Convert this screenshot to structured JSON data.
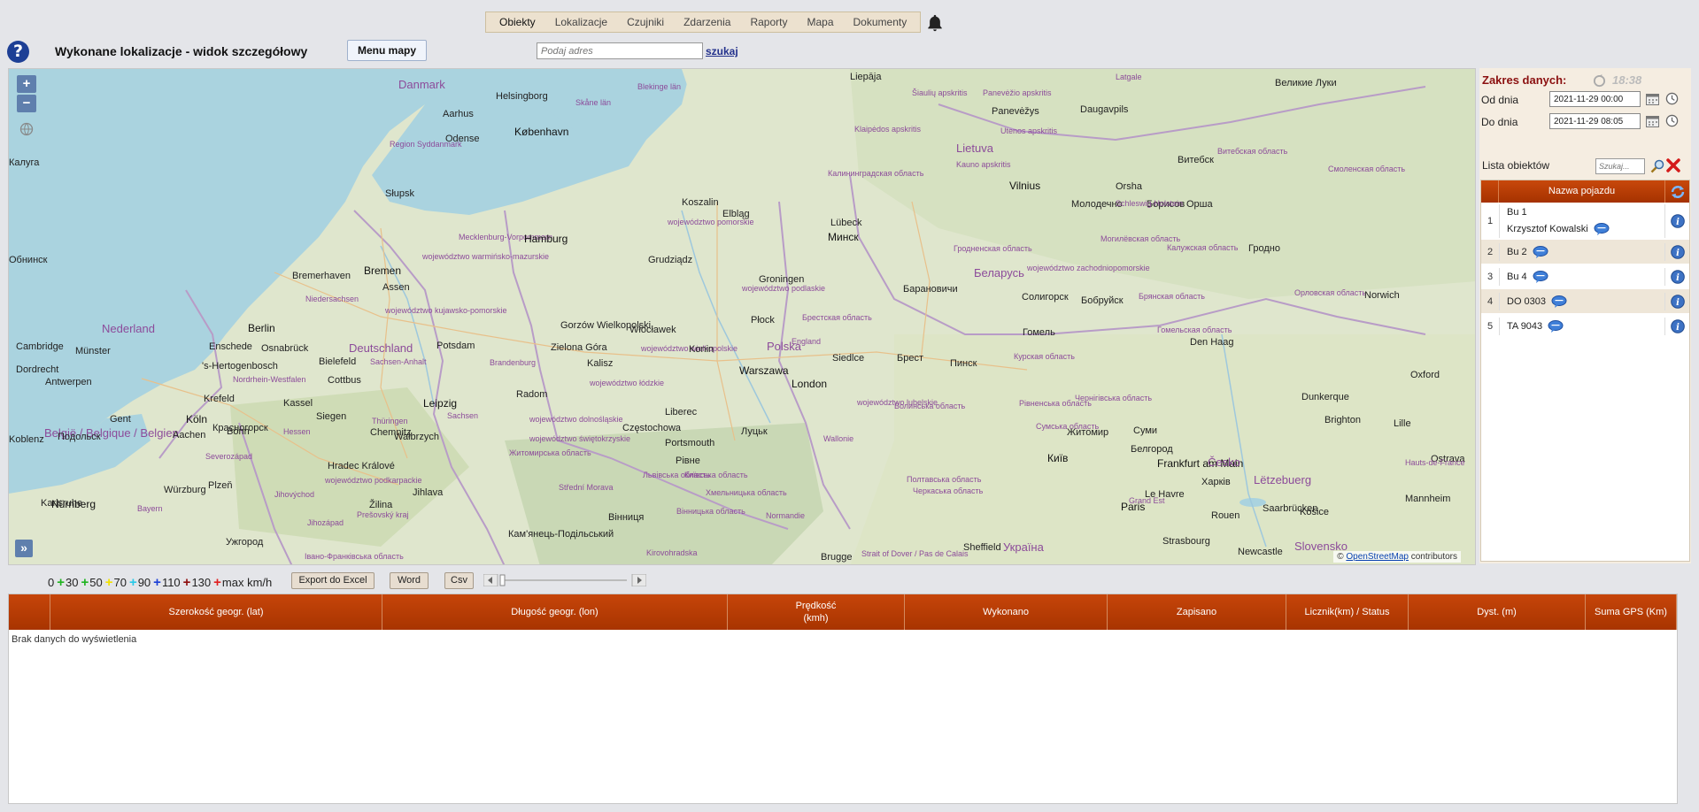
{
  "nav": {
    "items": [
      "Obiekty",
      "Lokalizacje",
      "Czujniki",
      "Zdarzenia",
      "Raporty",
      "Mapa",
      "Dokumenty"
    ]
  },
  "header": {
    "title": "Wykonane lokalizacje - widok szczegółowy",
    "menu_button": "Menu mapy",
    "address_placeholder": "Podaj adres",
    "search_link": "szukaj"
  },
  "map": {
    "zoom_in": "+",
    "zoom_out": "−",
    "expand": "»",
    "attribution_prefix": "©",
    "attribution_link": "OpenStreetMap",
    "attribution_suffix": "contributors",
    "labels": [
      {
        "text": "Liepāja",
        "cls": "city"
      },
      {
        "text": "Latgale",
        "cls": "region"
      },
      {
        "text": "Великие Луки",
        "cls": "city"
      },
      {
        "text": "Danmark",
        "cls": "country"
      },
      {
        "text": "Helsingborg",
        "cls": "city"
      },
      {
        "text": "Blekinge län",
        "cls": "region"
      },
      {
        "text": "Panevėžio apskritis",
        "cls": "region"
      },
      {
        "text": "Šiaulių apskritis",
        "cls": "region"
      },
      {
        "text": "Panevėžys",
        "cls": "city"
      },
      {
        "text": "Daugavpils",
        "cls": "city"
      },
      {
        "text": "Aarhus",
        "cls": "city"
      },
      {
        "text": "København",
        "cls": "capital"
      },
      {
        "text": "Skåne län",
        "cls": "region"
      },
      {
        "text": "Odense",
        "cls": "city"
      },
      {
        "text": "Region Syddanmark",
        "cls": "region"
      },
      {
        "text": "Klaipėdos apskritis",
        "cls": "region"
      },
      {
        "text": "Utenos apskritis",
        "cls": "region"
      },
      {
        "text": "Lietuva",
        "cls": "country"
      },
      {
        "text": "Kauno apskritis",
        "cls": "region"
      },
      {
        "text": "Витебская область",
        "cls": "region"
      },
      {
        "text": "Витебск",
        "cls": "city"
      },
      {
        "text": "Смоленская область",
        "cls": "region"
      },
      {
        "text": "Калининградская область",
        "cls": "region"
      },
      {
        "text": "Vilnius",
        "cls": "capital"
      },
      {
        "text": "Orsha",
        "cls": "city"
      },
      {
        "text": "Молодечно",
        "cls": "city"
      },
      {
        "text": "Борисов",
        "cls": "city"
      },
      {
        "text": "Орша",
        "cls": "city"
      },
      {
        "text": "Schleswig-Holstein",
        "cls": "region"
      },
      {
        "text": "Słupsk",
        "cls": "city"
      },
      {
        "text": "Koszalin",
        "cls": "city"
      },
      {
        "text": "województwo pomorskie",
        "cls": "region"
      },
      {
        "text": "Elbląg",
        "cls": "city"
      },
      {
        "text": "Lübeck",
        "cls": "city"
      },
      {
        "text": "Mecklenburg-Vorpommern",
        "cls": "region"
      },
      {
        "text": "Hamburg",
        "cls": "capital"
      },
      {
        "text": "województwo warmińsko-mazurskie",
        "cls": "region"
      },
      {
        "text": "Минск",
        "cls": "capital"
      },
      {
        "text": "Могилёвская область",
        "cls": "region"
      },
      {
        "text": "Калужская область",
        "cls": "region"
      },
      {
        "text": "Гродно",
        "cls": "city"
      },
      {
        "text": "Гродненская область",
        "cls": "region"
      },
      {
        "text": "Беларусь",
        "cls": "country"
      },
      {
        "text": "województwo zachodniopomorskie",
        "cls": "region"
      },
      {
        "text": "Grudziądz",
        "cls": "city"
      },
      {
        "text": "Groningen",
        "cls": "city"
      },
      {
        "text": "Bremerhaven",
        "cls": "city"
      },
      {
        "text": "Bremen",
        "cls": "capital"
      },
      {
        "text": "Assen",
        "cls": "city"
      },
      {
        "text": "Niedersachsen",
        "cls": "region"
      },
      {
        "text": "województwo kujawsko-pomorskie",
        "cls": "region"
      },
      {
        "text": "województwo podlaskie",
        "cls": "region"
      },
      {
        "text": "Барановичи",
        "cls": "city"
      },
      {
        "text": "Солигорск",
        "cls": "city"
      },
      {
        "text": "Бобруйск",
        "cls": "city"
      },
      {
        "text": "Брянская область",
        "cls": "region"
      },
      {
        "text": "Орловская область",
        "cls": "region"
      },
      {
        "text": "Norwich",
        "cls": "city"
      },
      {
        "text": "Nederland",
        "cls": "country"
      },
      {
        "text": "Berlin",
        "cls": "capital"
      },
      {
        "text": "Gorzów Wielkopolski",
        "cls": "city"
      },
      {
        "text": "Włocławek",
        "cls": "city"
      },
      {
        "text": "Płock",
        "cls": "city"
      },
      {
        "text": "Брестская область",
        "cls": "region"
      },
      {
        "text": "Гомель",
        "cls": "city"
      },
      {
        "text": "Гомельская область",
        "cls": "region"
      },
      {
        "text": "Den Haag",
        "cls": "city"
      },
      {
        "text": "Enschede",
        "cls": "city"
      },
      {
        "text": "Osnabrück",
        "cls": "city"
      },
      {
        "text": "Deutschland",
        "cls": "country"
      },
      {
        "text": "Potsdam",
        "cls": "city"
      },
      {
        "text": "Zielona Góra",
        "cls": "city"
      },
      {
        "text": "województwo wielkopolskie",
        "cls": "region"
      },
      {
        "text": "Konin",
        "cls": "city"
      },
      {
        "text": "Polska",
        "cls": "country"
      },
      {
        "text": "England",
        "cls": "region"
      },
      {
        "text": "Cambridge",
        "cls": "city"
      },
      {
        "text": "Münster",
        "cls": "city"
      },
      {
        "text": "Bielefeld",
        "cls": "city"
      },
      {
        "text": "Sachsen-Anhalt",
        "cls": "region"
      },
      {
        "text": "Brandenburg",
        "cls": "region"
      },
      {
        "text": "Kalisz",
        "cls": "city"
      },
      {
        "text": "Warszawa",
        "cls": "capital"
      },
      {
        "text": "Siedlce",
        "cls": "city"
      },
      {
        "text": "Брест",
        "cls": "city"
      },
      {
        "text": "Пинск",
        "cls": "city"
      },
      {
        "text": "Курская область",
        "cls": "region"
      },
      {
        "text": "Oxford",
        "cls": "city"
      },
      {
        "text": "Dordrecht",
        "cls": "city"
      },
      {
        "text": "'s-Hertogenbosch",
        "cls": "city"
      },
      {
        "text": "Nordrhein-Westfalen",
        "cls": "region"
      },
      {
        "text": "Cottbus",
        "cls": "city"
      },
      {
        "text": "województwo łódzkie",
        "cls": "region"
      },
      {
        "text": "London",
        "cls": "capital"
      },
      {
        "text": "Antwerpen",
        "cls": "city"
      },
      {
        "text": "Krefeld",
        "cls": "city"
      },
      {
        "text": "Kassel",
        "cls": "city"
      },
      {
        "text": "Leipzig",
        "cls": "capital"
      },
      {
        "text": "Radom",
        "cls": "city"
      },
      {
        "text": "województwo lubelskie",
        "cls": "region"
      },
      {
        "text": "Волинська область",
        "cls": "region"
      },
      {
        "text": "Рівненська область",
        "cls": "region"
      },
      {
        "text": "Чернігівська область",
        "cls": "region"
      },
      {
        "text": "Dunkerque",
        "cls": "city"
      },
      {
        "text": "Gent",
        "cls": "city"
      },
      {
        "text": "Köln",
        "cls": "capital"
      },
      {
        "text": "Siegen",
        "cls": "city"
      },
      {
        "text": "Thüringen",
        "cls": "region"
      },
      {
        "text": "Sachsen",
        "cls": "region"
      },
      {
        "text": "województwo dolnośląskie",
        "cls": "region"
      },
      {
        "text": "Liberec",
        "cls": "city"
      },
      {
        "text": "Częstochowa",
        "cls": "city"
      },
      {
        "text": "Луцьк",
        "cls": "city"
      },
      {
        "text": "Сумська область",
        "cls": "region"
      },
      {
        "text": "Суми",
        "cls": "city"
      },
      {
        "text": "Brighton",
        "cls": "city"
      },
      {
        "text": "Lille",
        "cls": "city"
      },
      {
        "text": "België / Belgique / Belgien",
        "cls": "country"
      },
      {
        "text": "Aachen",
        "cls": "city"
      },
      {
        "text": "Bonn",
        "cls": "city"
      },
      {
        "text": "Hessen",
        "cls": "region"
      },
      {
        "text": "Chemnitz",
        "cls": "city"
      },
      {
        "text": "Wałbrzych",
        "cls": "city"
      },
      {
        "text": "województwo świętokrzyskie",
        "cls": "region"
      },
      {
        "text": "Portsmouth",
        "cls": "city"
      },
      {
        "text": "Wallonie",
        "cls": "region"
      },
      {
        "text": "Koblenz",
        "cls": "city"
      },
      {
        "text": "Severozápad",
        "cls": "region"
      },
      {
        "text": "Hradec Králové",
        "cls": "city"
      },
      {
        "text": "Житомирська область",
        "cls": "region"
      },
      {
        "text": "Рівне",
        "cls": "city"
      },
      {
        "text": "Житомир",
        "cls": "city"
      },
      {
        "text": "Київ",
        "cls": "capital"
      },
      {
        "text": "Белгород",
        "cls": "city"
      },
      {
        "text": "Frankfurt am Main",
        "cls": "capital"
      },
      {
        "text": "Česko",
        "cls": "country"
      },
      {
        "text": "Ostrava",
        "cls": "city"
      },
      {
        "text": "województwo podkarpackie",
        "cls": "region"
      },
      {
        "text": "Львівська область",
        "cls": "region"
      },
      {
        "text": "Київська область",
        "cls": "region"
      },
      {
        "text": "Полтавська область",
        "cls": "region"
      },
      {
        "text": "Харків",
        "cls": "city"
      },
      {
        "text": "Hauts-de-France",
        "cls": "region"
      },
      {
        "text": "Lëtzebuerg",
        "cls": "country"
      },
      {
        "text": "Würzburg",
        "cls": "city"
      },
      {
        "text": "Plzeň",
        "cls": "city"
      },
      {
        "text": "Jihlava",
        "cls": "city"
      },
      {
        "text": "Střední Morava",
        "cls": "region"
      },
      {
        "text": "Хмельницька область",
        "cls": "region"
      },
      {
        "text": "Черкаська область",
        "cls": "region"
      },
      {
        "text": "Le Havre",
        "cls": "city"
      },
      {
        "text": "Rouen",
        "cls": "city"
      },
      {
        "text": "Mannheim",
        "cls": "city"
      },
      {
        "text": "Nürnberg",
        "cls": "capital"
      },
      {
        "text": "Jihovýchod",
        "cls": "region"
      },
      {
        "text": "Žilina",
        "cls": "city"
      },
      {
        "text": "Вінниця",
        "cls": "city"
      },
      {
        "text": "Normandie",
        "cls": "region"
      },
      {
        "text": "Paris",
        "cls": "capital"
      },
      {
        "text": "Saarbrücken",
        "cls": "city"
      },
      {
        "text": "Karlsruhe",
        "cls": "city"
      },
      {
        "text": "Bayern",
        "cls": "region"
      },
      {
        "text": "Jihozápad",
        "cls": "region"
      },
      {
        "text": "Prešovský kraj",
        "cls": "region"
      },
      {
        "text": "Кам'янець-Подільський",
        "cls": "city"
      },
      {
        "text": "Вінницька область",
        "cls": "region"
      },
      {
        "text": "Україна",
        "cls": "country"
      },
      {
        "text": "Grand Est",
        "cls": "region"
      },
      {
        "text": "Strasbourg",
        "cls": "city"
      },
      {
        "text": "Slovensko",
        "cls": "country"
      },
      {
        "text": "Košice",
        "cls": "city"
      },
      {
        "text": "Ужгород",
        "cls": "city"
      },
      {
        "text": "Івано-Франківська область",
        "cls": "region"
      },
      {
        "text": "Kirovohradska",
        "cls": "region"
      },
      {
        "text": "Brugge",
        "cls": "city"
      },
      {
        "text": "Strait of Dover / Pas de Calais",
        "cls": "region"
      },
      {
        "text": "Sheffield",
        "cls": "city"
      },
      {
        "text": "Newcastle",
        "cls": "city"
      },
      {
        "text": "Красногорск",
        "cls": "city"
      },
      {
        "text": "Подольск",
        "cls": "city"
      },
      {
        "text": "Обнинск",
        "cls": "city"
      },
      {
        "text": "Калуга",
        "cls": "city"
      }
    ]
  },
  "right_panel": {
    "range_title": "Zakres danych:",
    "time": "18:38",
    "from_label": "Od dnia",
    "from_value": "2021-11-29 00:00",
    "to_label": "Do dnia",
    "to_value": "2021-11-29 08:05",
    "objects_label": "Lista obiektów",
    "search_placeholder": "Szukaj...",
    "table_header": "Nazwa pojazdu",
    "vehicles": [
      {
        "num": "1",
        "name": "Bu 1",
        "driver": "Krzysztof Kowalski"
      },
      {
        "num": "2",
        "name": "Bu 2",
        "driver": ""
      },
      {
        "num": "3",
        "name": "Bu 4",
        "driver": ""
      },
      {
        "num": "4",
        "name": "DO 0303",
        "driver": ""
      },
      {
        "num": "5",
        "name": "TA 9043",
        "driver": ""
      }
    ]
  },
  "legend": {
    "items": [
      {
        "label": "0",
        "color": ""
      },
      {
        "label": "30",
        "color": "#21b421"
      },
      {
        "label": "50",
        "color": "#21b421"
      },
      {
        "label": "70",
        "color": "#f2e200"
      },
      {
        "label": "90",
        "color": "#28c9e8"
      },
      {
        "label": "110",
        "color": "#1b3fd6"
      },
      {
        "label": "130",
        "color": "#8e0e0e"
      },
      {
        "label": "max km/h",
        "color": "#e02020"
      }
    ],
    "export_excel": "Export do Excel",
    "word": "Word",
    "csv": "Csv"
  },
  "results": {
    "columns": [
      "",
      "Szerokość geogr. (lat)",
      "Długość geogr. (lon)",
      "Prędkość\n(kmh)",
      "Wykonano",
      "Zapisano",
      "Licznik(km) / Status",
      "Dyst. (m)",
      "Suma GPS (Km)"
    ],
    "empty_text": "Brak danych do wyświetlenia"
  },
  "colors": {
    "header_orange": "#b83d05",
    "panel_bg": "#f5ede1",
    "title_red": "#8b1010"
  }
}
